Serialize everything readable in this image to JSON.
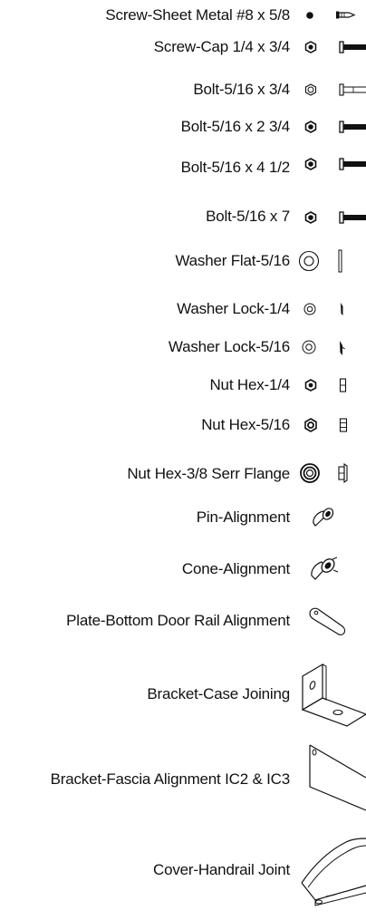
{
  "parts": [
    {
      "label": "Screw-Sheet Metal #8 x 5/8",
      "icons": [
        "dot-icon",
        "sheet-metal-screw-icon"
      ]
    },
    {
      "label": "Screw-Cap 1/4 x 3/4",
      "icons": [
        "hex-head-icon",
        "cap-screw-icon"
      ]
    },
    {
      "label": "Bolt-5/16 x 3/4",
      "icons": [
        "hex-head-icon",
        "short-bolt-icon"
      ]
    },
    {
      "label": "Bolt-5/16 x 2 3/4",
      "icons": [
        "hex-head-icon",
        "bolt-icon"
      ]
    },
    {
      "label": "Bolt-5/16 x 4 1/2",
      "icons": [
        "hex-head-icon",
        "bolt-icon"
      ]
    },
    {
      "label": "Bolt-5/16 x 7",
      "icons": [
        "hex-head-icon",
        "bolt-icon"
      ]
    },
    {
      "label": "Washer Flat-5/16",
      "icons": [
        "flat-washer-icon",
        "washer-side-icon"
      ]
    },
    {
      "label": "Washer Lock-1/4",
      "icons": [
        "lock-washer-icon",
        "lock-washer-side-icon"
      ]
    },
    {
      "label": "Washer Lock-5/16",
      "icons": [
        "lock-washer-icon",
        "lock-washer-side-icon"
      ]
    },
    {
      "label": "Nut Hex-1/4",
      "icons": [
        "hex-nut-icon",
        "hex-nut-side-icon"
      ]
    },
    {
      "label": "Nut Hex-5/16",
      "icons": [
        "hex-nut-icon",
        "hex-nut-side-icon"
      ]
    },
    {
      "label": "Nut Hex-3/8 Serr Flange",
      "icons": [
        "flange-nut-icon",
        "flange-nut-side-icon"
      ]
    },
    {
      "label": "Pin-Alignment",
      "icons": [
        "alignment-pin-icon"
      ]
    },
    {
      "label": "Cone-Alignment",
      "icons": [
        "alignment-cone-icon"
      ]
    },
    {
      "label": "Plate-Bottom Door Rail Alignment",
      "icons": [
        "alignment-plate-icon"
      ]
    },
    {
      "label": "Bracket-Case Joining",
      "icons": [
        "joining-bracket-icon"
      ]
    },
    {
      "label": "Bracket-Fascia Alignment IC2 & IC3",
      "icons": [
        "fascia-bracket-icon"
      ]
    },
    {
      "label": "Cover-Handrail Joint",
      "icons": [
        "handrail-cover-icon"
      ]
    }
  ]
}
